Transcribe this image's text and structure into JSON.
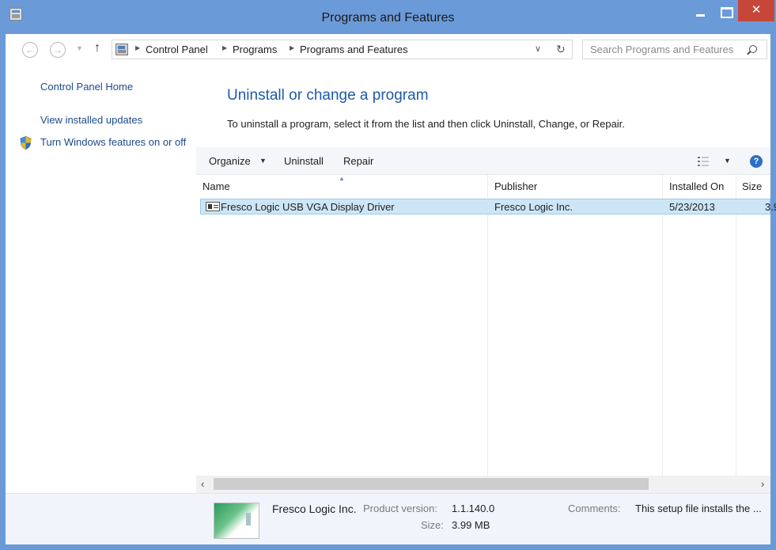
{
  "window": {
    "title": "Programs and Features",
    "close_label": "✕"
  },
  "address_bar": {
    "breadcrumbs": [
      "Control Panel",
      "Programs",
      "Programs and Features"
    ]
  },
  "search": {
    "placeholder": "Search Programs and Features"
  },
  "left_pane": {
    "links": [
      "Control Panel Home",
      "View installed updates",
      "Turn Windows features on or off"
    ]
  },
  "main": {
    "heading": "Uninstall or change a program",
    "instructions": "To uninstall a program, select it from the list and then click Uninstall, Change, or Repair."
  },
  "toolbar": {
    "organize_label": "Organize",
    "uninstall_label": "Uninstall",
    "repair_label": "Repair",
    "help_label": "?"
  },
  "table": {
    "columns": [
      "Name",
      "Publisher",
      "Installed On",
      "Size"
    ],
    "rows": [
      {
        "name": "Fresco Logic USB VGA Display Driver",
        "publisher": "Fresco Logic Inc.",
        "installed_on": "5/23/2013",
        "size": "3.9"
      }
    ]
  },
  "details": {
    "publisher": "Fresco Logic Inc.",
    "product_version_label": "Product version:",
    "product_version": "1.1.140.0",
    "size_label": "Size:",
    "size": "3.99 MB",
    "comments_label": "Comments:",
    "comments": "This setup file installs the ..."
  },
  "colors": {
    "title_bar": "#6b9ad9",
    "close_button": "#c7463a",
    "heading": "#1e5aa8",
    "link": "#1c4a8c",
    "selected_row": "#cde6f7"
  }
}
